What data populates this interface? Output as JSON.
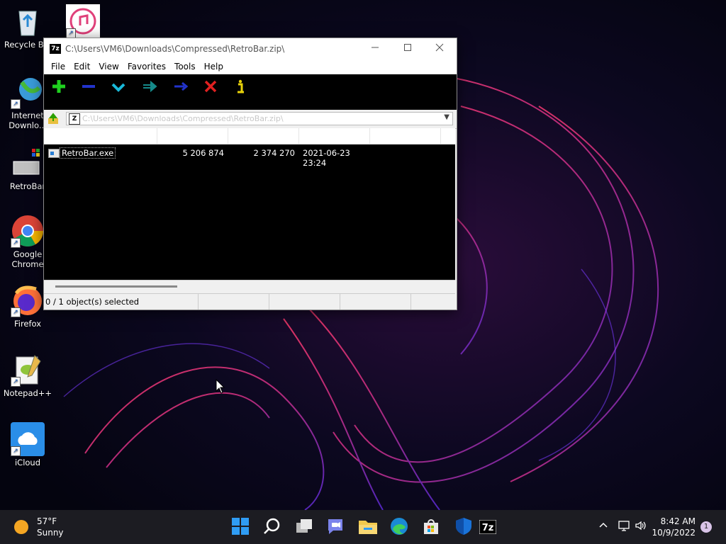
{
  "desktop": {
    "icons": [
      {
        "label": "Recycle Bin",
        "icon": "recycle-bin-icon"
      },
      {
        "label": "",
        "icon": "itunes-icon"
      },
      {
        "label": "Internet Downlo...",
        "icon": "internet-download-manager-icon"
      },
      {
        "label": "RetroBar",
        "icon": "retrobar-icon"
      },
      {
        "label": "Google Chrome",
        "icon": "chrome-icon"
      },
      {
        "label": "Firefox",
        "icon": "firefox-icon"
      },
      {
        "label": "Notepad++",
        "icon": "notepad-plus-plus-icon"
      },
      {
        "label": "iCloud",
        "icon": "icloud-icon"
      }
    ]
  },
  "window": {
    "app_icon": "7z",
    "title": "C:\\Users\\VM6\\Downloads\\Compressed\\RetroBar.zip\\",
    "menu": [
      "File",
      "Edit",
      "View",
      "Favorites",
      "Tools",
      "Help"
    ],
    "toolbar": [
      {
        "icon": "add-icon",
        "color": "#1fd11f"
      },
      {
        "icon": "extract-icon",
        "color": "#2233cc"
      },
      {
        "icon": "test-icon",
        "color": "#19b9d9"
      },
      {
        "icon": "copy-icon",
        "color": "#168a8a"
      },
      {
        "icon": "move-icon",
        "color": "#2233cc"
      },
      {
        "icon": "delete-icon",
        "color": "#e02020"
      },
      {
        "icon": "info-icon",
        "color": "#e8d20a"
      }
    ],
    "address": "C:\\Users\\VM6\\Downloads\\Compressed\\RetroBar.zip\\",
    "files": [
      {
        "name": "RetroBar.exe",
        "size": "5 206 874",
        "packed": "2 374 270",
        "modified": "2021-06-23 23:24"
      }
    ],
    "status": "0 / 1 object(s) selected"
  },
  "taskbar": {
    "weather_temp": "57°F",
    "weather_desc": "Sunny",
    "time": "8:42 AM",
    "date": "10/9/2022",
    "notifications": "1",
    "tray_chevron": "^",
    "apps": [
      "start-icon",
      "search-icon",
      "task-view-icon",
      "teams-chat-icon",
      "file-explorer-icon",
      "edge-icon",
      "store-icon",
      "defender-icon",
      "7zip-taskbar-icon"
    ]
  }
}
